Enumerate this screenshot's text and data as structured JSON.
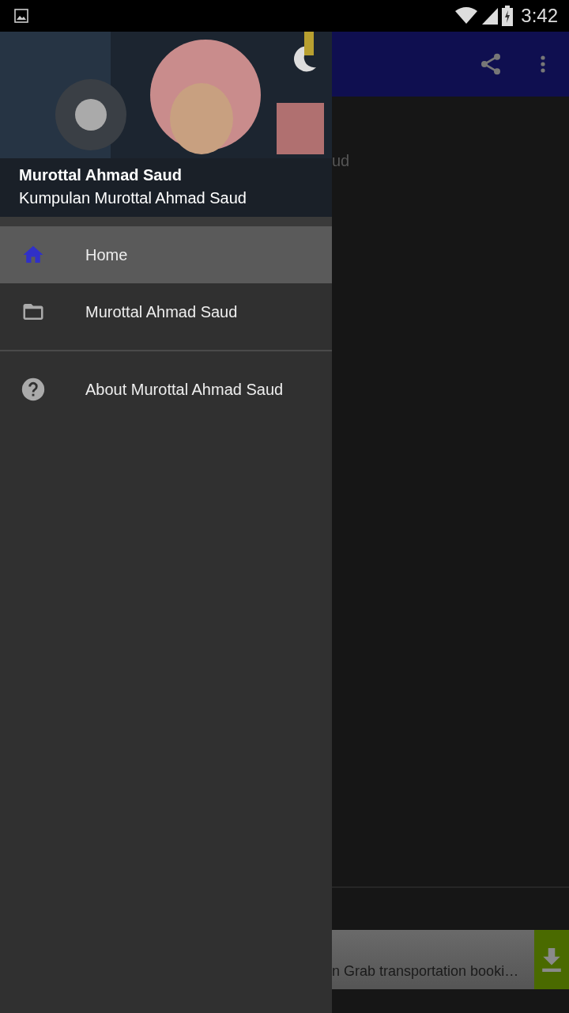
{
  "status_bar": {
    "time": "3:42"
  },
  "drawer": {
    "header": {
      "title": "Murottal Ahmad Saud",
      "subtitle": "Kumpulan Murottal Ahmad Saud"
    },
    "groups": [
      {
        "items": [
          {
            "label": "Home",
            "selected": true
          },
          {
            "label": "Murottal Ahmad Saud",
            "selected": false
          }
        ]
      },
      {
        "items": [
          {
            "label": "About Murottal Ahmad Saud",
            "selected": false
          }
        ]
      }
    ]
  },
  "main": {
    "text_fragment": "ud",
    "ad_text": "n Grab transportation booki…"
  }
}
